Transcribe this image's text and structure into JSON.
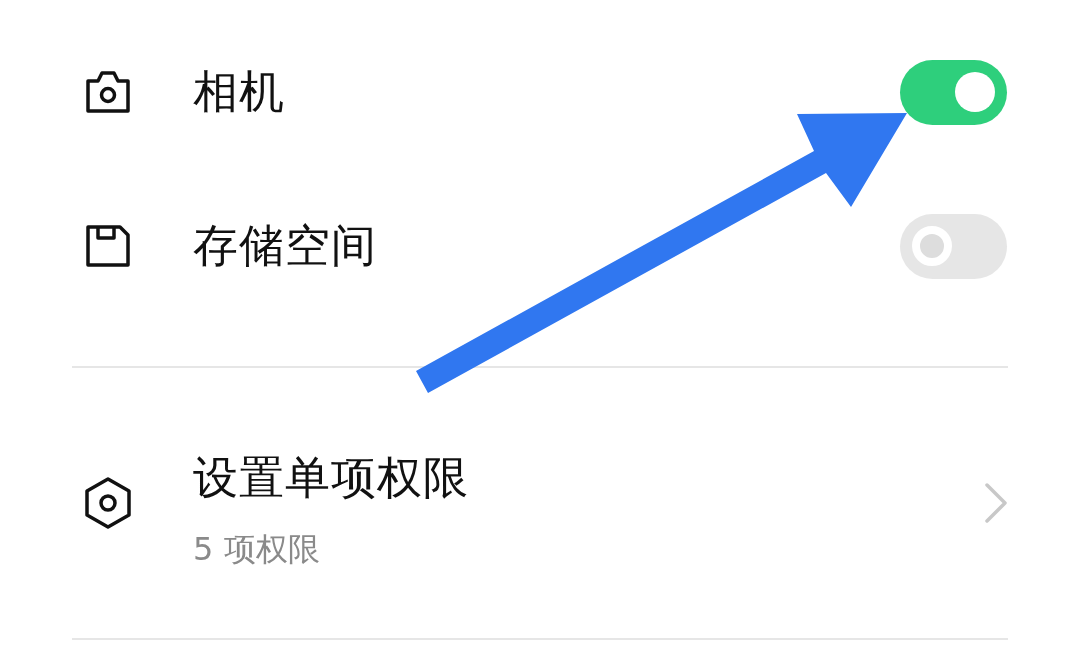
{
  "permissions": [
    {
      "kind": "toggle",
      "label": "相机",
      "on": true
    },
    {
      "kind": "toggle",
      "label": "存储空间",
      "on": false
    }
  ],
  "settings_item": {
    "title": "设置单项权限",
    "subtitle": "5 项权限"
  }
}
